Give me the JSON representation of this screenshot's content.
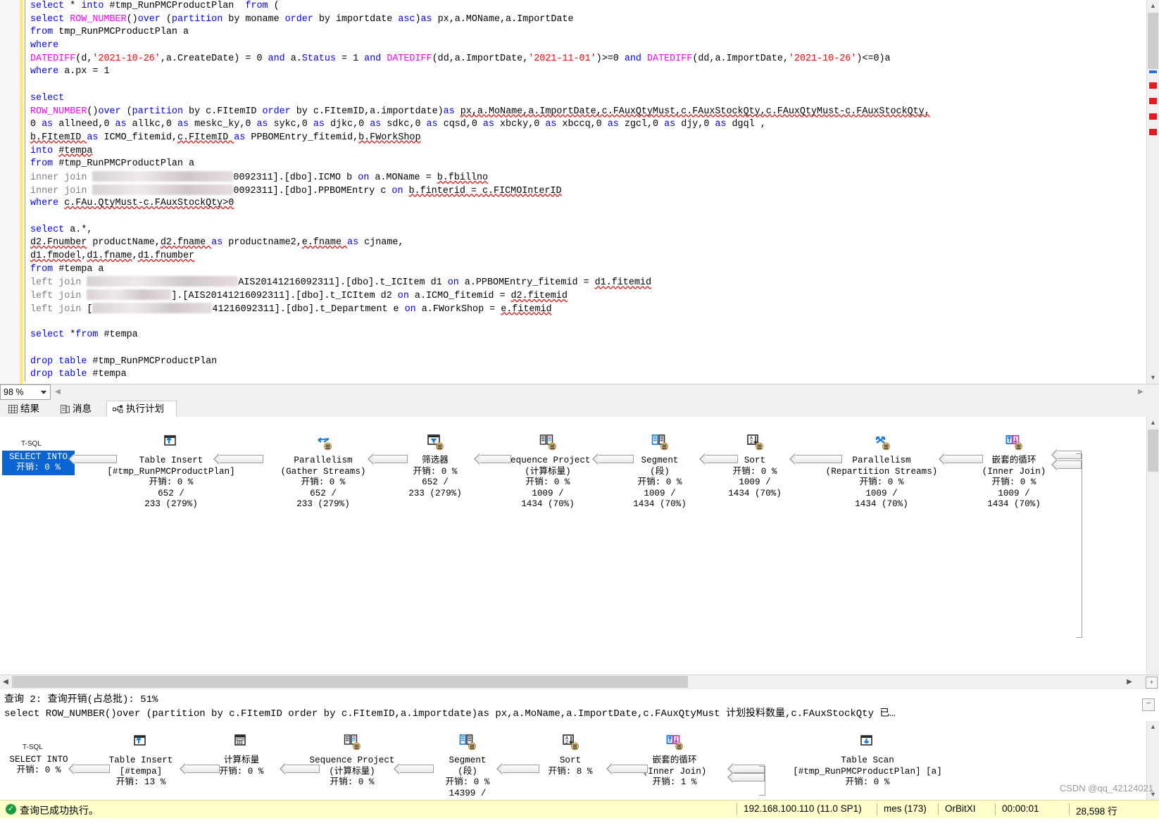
{
  "editor": {
    "zoom_level": "98 %",
    "lines": [
      {
        "fold": "minus",
        "indent": 0,
        "tokens": [
          {
            "t": "select ",
            "c": "k"
          },
          {
            "t": "* ",
            "c": "t"
          },
          {
            "t": "into ",
            "c": "k"
          },
          {
            "t": "#tmp_RunPMCProductPlan  ",
            "c": "t"
          },
          {
            "t": "from ",
            "c": "k"
          },
          {
            "t": "(",
            "c": "t"
          }
        ]
      },
      {
        "indent": 1,
        "tokens": [
          {
            "t": "select ",
            "c": "k"
          },
          {
            "t": "ROW_NUMBER",
            "c": "f"
          },
          {
            "t": "()",
            "c": "t"
          },
          {
            "t": "over ",
            "c": "k"
          },
          {
            "t": "(",
            "c": "t"
          },
          {
            "t": "partition ",
            "c": "k"
          },
          {
            "t": "by moname ",
            "c": "t"
          },
          {
            "t": "order ",
            "c": "k"
          },
          {
            "t": "by importdate ",
            "c": "t"
          },
          {
            "t": "asc",
            "c": "k"
          },
          {
            "t": ")",
            "c": "t"
          },
          {
            "t": "as ",
            "c": "k"
          },
          {
            "t": "px,a.MOName,a.ImportDate",
            "c": "t"
          }
        ]
      },
      {
        "indent": 1,
        "tokens": [
          {
            "t": "from ",
            "c": "k"
          },
          {
            "t": "tmp_RunPMCProductPlan a",
            "c": "t"
          }
        ]
      },
      {
        "indent": 1,
        "tokens": [
          {
            "t": "where",
            "c": "k"
          }
        ]
      },
      {
        "indent": 1,
        "tokens": [
          {
            "t": "DATEDIFF",
            "c": "f"
          },
          {
            "t": "(d,",
            "c": "t"
          },
          {
            "t": "'2021-10-26'",
            "c": "s"
          },
          {
            "t": ",a.CreateDate) = 0 ",
            "c": "t"
          },
          {
            "t": "and ",
            "c": "k"
          },
          {
            "t": "a.",
            "c": "t"
          },
          {
            "t": "Status",
            "c": "k"
          },
          {
            "t": " = 1 ",
            "c": "t"
          },
          {
            "t": "and ",
            "c": "k"
          },
          {
            "t": "DATEDIFF",
            "c": "f"
          },
          {
            "t": "(dd,a.ImportDate,",
            "c": "t"
          },
          {
            "t": "'2021-11-01'",
            "c": "s"
          },
          {
            "t": ")>=0 ",
            "c": "t"
          },
          {
            "t": "and ",
            "c": "k"
          },
          {
            "t": "DATEDIFF",
            "c": "f"
          },
          {
            "t": "(dd,a.ImportDate,",
            "c": "t"
          },
          {
            "t": "'2021-10-26'",
            "c": "s"
          },
          {
            "t": ")<=0)a",
            "c": "t"
          }
        ]
      },
      {
        "indent": 1,
        "tokens": [
          {
            "t": "where ",
            "c": "k"
          },
          {
            "t": "a.px = 1",
            "c": "t"
          }
        ]
      },
      {
        "indent": 1,
        "tokens": []
      },
      {
        "fold": "minus",
        "indent": 0,
        "tokens": [
          {
            "t": "select",
            "c": "k"
          }
        ]
      },
      {
        "indent": 1,
        "tokens": [
          {
            "t": "ROW_NUMBER",
            "c": "f"
          },
          {
            "t": "()",
            "c": "t"
          },
          {
            "t": "over ",
            "c": "k"
          },
          {
            "t": "(",
            "c": "t"
          },
          {
            "t": "partition ",
            "c": "k"
          },
          {
            "t": "by c.FItemID ",
            "c": "t"
          },
          {
            "t": "order ",
            "c": "k"
          },
          {
            "t": "by c.FItemID,a.importdate",
            "c": "t"
          },
          {
            "t": ")",
            "c": "t"
          },
          {
            "t": "as ",
            "c": "k"
          },
          {
            "t": "px,a.MoName,a.ImportDate,c.FAuxQtyMust,c.FAuxStockQty,c.FAuxQtyMust-c.FAuxStockQty,",
            "c": "w"
          }
        ]
      },
      {
        "indent": 1,
        "tokens": [
          {
            "t": "0 ",
            "c": "t"
          },
          {
            "t": "as ",
            "c": "k"
          },
          {
            "t": "allneed,0 ",
            "c": "t"
          },
          {
            "t": "as ",
            "c": "k"
          },
          {
            "t": "allkc,0 ",
            "c": "t"
          },
          {
            "t": "as ",
            "c": "k"
          },
          {
            "t": "meskc_ky,0 ",
            "c": "t"
          },
          {
            "t": "as ",
            "c": "k"
          },
          {
            "t": "sykc,0 ",
            "c": "t"
          },
          {
            "t": "as ",
            "c": "k"
          },
          {
            "t": "djkc,0 ",
            "c": "t"
          },
          {
            "t": "as ",
            "c": "k"
          },
          {
            "t": "sdkc,0 ",
            "c": "t"
          },
          {
            "t": "as ",
            "c": "k"
          },
          {
            "t": "cqsd,0 ",
            "c": "t"
          },
          {
            "t": "as ",
            "c": "k"
          },
          {
            "t": "xbcky,0 ",
            "c": "t"
          },
          {
            "t": "as ",
            "c": "k"
          },
          {
            "t": "xbccq,0 ",
            "c": "t"
          },
          {
            "t": "as ",
            "c": "k"
          },
          {
            "t": "zgcl,0 ",
            "c": "t"
          },
          {
            "t": "as ",
            "c": "k"
          },
          {
            "t": "djy,0 ",
            "c": "t"
          },
          {
            "t": "as ",
            "c": "k"
          },
          {
            "t": "dgql ,",
            "c": "t"
          }
        ]
      },
      {
        "indent": 1,
        "tokens": [
          {
            "t": "b.FItemID ",
            "c": "w"
          },
          {
            "t": "as ",
            "c": "k"
          },
          {
            "t": "ICMO_fitemid,",
            "c": "t"
          },
          {
            "t": "c.FItemID ",
            "c": "w"
          },
          {
            "t": "as ",
            "c": "k"
          },
          {
            "t": "PPBOMEntry_fitemid,",
            "c": "t"
          },
          {
            "t": "b.FWorkShop",
            "c": "w"
          }
        ]
      },
      {
        "indent": 1,
        "tokens": [
          {
            "t": "into ",
            "c": "k"
          },
          {
            "t": "#tempa",
            "c": "w"
          }
        ]
      },
      {
        "indent": 1,
        "tokens": [
          {
            "t": "from ",
            "c": "k"
          },
          {
            "t": "#tmp_RunPMCProductPlan a",
            "c": "t"
          }
        ]
      },
      {
        "indent": 1,
        "tokens": [
          {
            "t": "inner join ",
            "c": "g"
          },
          {
            "t": "__REDACT1__",
            "c": "redact"
          },
          {
            "t": "0092311].[dbo].ICMO b ",
            "c": "t"
          },
          {
            "t": "on ",
            "c": "k"
          },
          {
            "t": "a.MOName = ",
            "c": "t"
          },
          {
            "t": "b.fbillno",
            "c": "w"
          }
        ]
      },
      {
        "indent": 1,
        "tokens": [
          {
            "t": "inner join ",
            "c": "g"
          },
          {
            "t": "__REDACT2__",
            "c": "redact"
          },
          {
            "t": "0092311].[dbo].PPBOMEntry c ",
            "c": "t"
          },
          {
            "t": "on ",
            "c": "k"
          },
          {
            "t": "b.finterid = ",
            "c": "w"
          },
          {
            "t": "c.FICMOInterID",
            "c": "w"
          }
        ]
      },
      {
        "indent": 1,
        "tokens": [
          {
            "t": "where ",
            "c": "k"
          },
          {
            "t": "c.FAu.QtyMust-c.FAuxStockQty>0",
            "c": "w"
          }
        ]
      },
      {
        "indent": 1,
        "tokens": []
      },
      {
        "fold": "minus",
        "indent": 0,
        "tokens": [
          {
            "t": "select ",
            "c": "k"
          },
          {
            "t": "a.*,",
            "c": "t"
          }
        ]
      },
      {
        "indent": 1,
        "tokens": [
          {
            "t": "d2.Fnumber",
            "c": "w"
          },
          {
            "t": " productName,",
            "c": "t"
          },
          {
            "t": "d2.fname ",
            "c": "w"
          },
          {
            "t": "as ",
            "c": "k"
          },
          {
            "t": "productname2,",
            "c": "t"
          },
          {
            "t": "e.fname ",
            "c": "w"
          },
          {
            "t": "as ",
            "c": "k"
          },
          {
            "t": "cjname,",
            "c": "t"
          }
        ]
      },
      {
        "indent": 1,
        "tokens": [
          {
            "t": "d1.fmodel",
            "c": "w"
          },
          {
            "t": ",",
            "c": "t"
          },
          {
            "t": "d1.fname",
            "c": "w"
          },
          {
            "t": ",",
            "c": "t"
          },
          {
            "t": "d1.fnumber",
            "c": "w"
          }
        ]
      },
      {
        "indent": 1,
        "tokens": [
          {
            "t": "from ",
            "c": "k"
          },
          {
            "t": "#tempa a",
            "c": "t"
          }
        ]
      },
      {
        "indent": 1,
        "tokens": [
          {
            "t": "left join ",
            "c": "g"
          },
          {
            "t": "__REDACT3__",
            "c": "redact"
          },
          {
            "t": "AIS20141216092311].[dbo].t_ICItem d1 ",
            "c": "t"
          },
          {
            "t": "on ",
            "c": "k"
          },
          {
            "t": "a.PPBOMEntry_fitemid = ",
            "c": "t"
          },
          {
            "t": "d1.fitemid",
            "c": "w"
          }
        ]
      },
      {
        "indent": 1,
        "tokens": [
          {
            "t": "left join ",
            "c": "g"
          },
          {
            "t": "__REDACT4__",
            "c": "redact"
          },
          {
            "t": "].[AIS20141216092311].[dbo].t_ICItem d2 ",
            "c": "t"
          },
          {
            "t": "on ",
            "c": "k"
          },
          {
            "t": "a.ICMO_fitemid = ",
            "c": "t"
          },
          {
            "t": "d2.fitemid",
            "c": "w"
          }
        ]
      },
      {
        "indent": 1,
        "tokens": [
          {
            "t": "left join ",
            "c": "g"
          },
          {
            "t": "[",
            "c": "t"
          },
          {
            "t": "__REDACT5__",
            "c": "redact"
          },
          {
            "t": "41216092311].[dbo].t_Department e ",
            "c": "t"
          },
          {
            "t": "on ",
            "c": "k"
          },
          {
            "t": "a.FWorkShop = ",
            "c": "t"
          },
          {
            "t": "e.fitemid",
            "c": "w"
          }
        ]
      },
      {
        "indent": 1,
        "tokens": []
      },
      {
        "indent": 1,
        "tokens": [
          {
            "t": "select ",
            "c": "k"
          },
          {
            "t": "*",
            "c": "t"
          },
          {
            "t": "from ",
            "c": "k"
          },
          {
            "t": "#tempa",
            "c": "t"
          }
        ]
      },
      {
        "indent": 1,
        "tokens": []
      },
      {
        "indent": 1,
        "tokens": [
          {
            "t": "drop ",
            "c": "k"
          },
          {
            "t": "table ",
            "c": "k"
          },
          {
            "t": "#tmp_RunPMCProductPlan",
            "c": "t"
          }
        ]
      },
      {
        "indent": 1,
        "tokens": [
          {
            "t": "drop ",
            "c": "k"
          },
          {
            "t": "table ",
            "c": "k"
          },
          {
            "t": "#tempa",
            "c": "t"
          }
        ]
      }
    ]
  },
  "tabs": [
    {
      "label": "结果",
      "icon": "grid-icon",
      "active": false
    },
    {
      "label": "消息",
      "icon": "message-icon",
      "active": false
    },
    {
      "label": "执行计划",
      "icon": "plan-icon",
      "active": true
    }
  ],
  "plan1": {
    "tsql_label": "T-SQL",
    "root": {
      "label": "SELECT INTO",
      "cost": "开销: 0 %"
    },
    "nodes": [
      {
        "icon": "table-insert-icon",
        "title": "Table Insert",
        "sub": "[#tmp_RunPMCProductPlan]",
        "cost": "开销: 0 %",
        "rows": "652 /",
        "pct": "233 (279%)"
      },
      {
        "icon": "parallelism-gather-icon",
        "title": "Parallelism",
        "sub": "(Gather Streams)",
        "cost": "开销: 0 %",
        "rows": "652 /",
        "pct": "233 (279%)"
      },
      {
        "icon": "filter-icon",
        "title": "筛选器",
        "sub": "",
        "cost": "开销: 0 %",
        "rows": "652 /",
        "pct": "233 (279%)"
      },
      {
        "icon": "sequence-project-icon",
        "title": "Sequence Project",
        "sub": "(计算标量)",
        "cost": "开销: 0 %",
        "rows": "1009 /",
        "pct": "1434 (70%)"
      },
      {
        "icon": "segment-icon",
        "title": "Segment",
        "sub": "(段)",
        "cost": "开销: 0 %",
        "rows": "1009 /",
        "pct": "1434 (70%)"
      },
      {
        "icon": "sort-icon",
        "title": "Sort",
        "sub": "",
        "cost": "开销: 0 %",
        "rows": "1009 /",
        "pct": "1434 (70%)"
      },
      {
        "icon": "parallelism-repartition-icon",
        "title": "Parallelism",
        "sub": "(Repartition Streams)",
        "cost": "开销: 0 %",
        "rows": "1009 /",
        "pct": "1434 (70%)"
      },
      {
        "icon": "nested-loops-icon",
        "title": "嵌套的循环",
        "sub": "(Inner Join)",
        "cost": "开销: 0 %",
        "rows": "1009 /",
        "pct": "1434 (70%)"
      }
    ]
  },
  "query2": {
    "header": "查询 2: 查询开销(占总批): 51%",
    "sql": "select ROW_NUMBER()over (partition by c.FItemID order by c.FItemID,a.importdate)as px,a.MoName,a.ImportDate,c.FAuxQtyMust 计划投料数量,c.FAuxStockQty 已…",
    "collapse_icon": "collapse-icon"
  },
  "plan2": {
    "tsql_label": "T-SQL",
    "root": {
      "label": "SELECT INTO",
      "cost": "开销: 0 %"
    },
    "nodes": [
      {
        "icon": "table-insert-icon",
        "title": "Table Insert",
        "sub": "[#tempa]",
        "cost": "开销: 13 %",
        "rows": ""
      },
      {
        "icon": "compute-scalar-icon",
        "title": "计算标量",
        "sub": "",
        "cost": "开销: 0 %",
        "rows": ""
      },
      {
        "icon": "sequence-project-icon",
        "title": "Sequence Project",
        "sub": "(计算标量)",
        "cost": "开销: 0 %",
        "rows": ""
      },
      {
        "icon": "segment-icon",
        "title": "Segment",
        "sub": "(段)",
        "cost": "开销: 0 %",
        "rows": "14399 /"
      },
      {
        "icon": "sort-icon",
        "title": "Sort",
        "sub": "",
        "cost": "开销: 8 %",
        "rows": ""
      },
      {
        "icon": "nested-loops-icon",
        "title": "嵌套的循环",
        "sub": "(Inner Join)",
        "cost": "开销: 1 %",
        "rows": ""
      },
      {
        "icon": "table-scan-icon",
        "title": "Table Scan",
        "sub": "[#tmp_RunPMCProductPlan] [a]",
        "cost": "开销: 0 %",
        "rows": ""
      }
    ]
  },
  "status": {
    "message": "查询已成功执行。",
    "server": "192.168.100.110 (11.0 SP1)",
    "user": "mes (173)",
    "database": "OrBitXI",
    "elapsed": "00:00:01",
    "rows": "28,598 行"
  },
  "watermark": "CSDN @qq_42124021"
}
